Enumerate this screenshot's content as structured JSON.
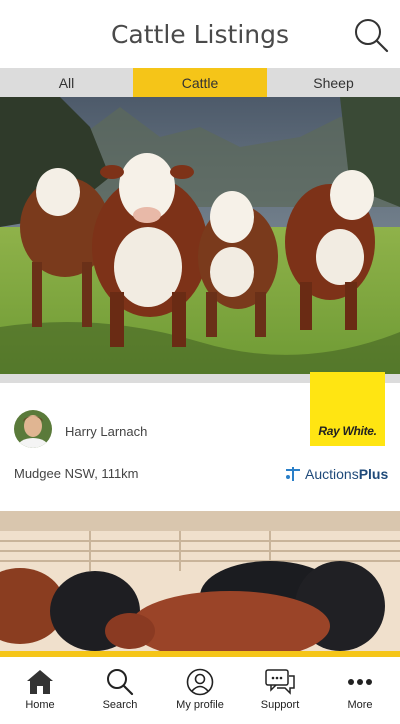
{
  "header": {
    "title": "Cattle Listings",
    "search_icon": "search-icon"
  },
  "tabs": [
    {
      "label": "All",
      "active": false
    },
    {
      "label": "Cattle",
      "active": true
    },
    {
      "label": "Sheep",
      "active": false
    }
  ],
  "listing": {
    "agent_name": "Harry Larnach",
    "agency_logo": "Ray White.",
    "location": "Mudgee NSW, 111km",
    "platform_logo": "AuctionsPlus",
    "platform_logo_parts": {
      "main": "Auctions",
      "bold": "Plus"
    }
  },
  "nav": [
    {
      "label": "Home",
      "icon": "home-icon"
    },
    {
      "label": "Search",
      "icon": "search-icon"
    },
    {
      "label": "My profile",
      "icon": "profile-icon"
    },
    {
      "label": "Support",
      "icon": "chat-icon"
    },
    {
      "label": "More",
      "icon": "more-icon"
    }
  ],
  "colors": {
    "accent": "#f5c518",
    "tab_bg": "#dcdcdc",
    "raywhite": "#ffe512",
    "auctionsplus": "#1f4a7a"
  }
}
